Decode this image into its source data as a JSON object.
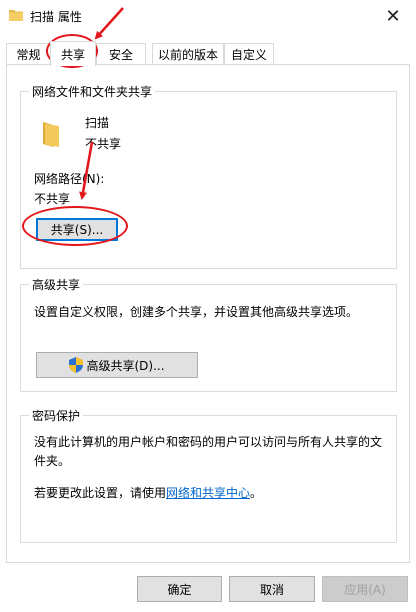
{
  "window": {
    "title": "扫描 属性",
    "close_glyph": "✕"
  },
  "tabs": [
    {
      "label": "常规",
      "active": false
    },
    {
      "label": "共享",
      "active": true
    },
    {
      "label": "安全",
      "active": false
    },
    {
      "label": "以前的版本",
      "active": false
    },
    {
      "label": "自定义",
      "active": false
    }
  ],
  "network_sharing": {
    "group_label": "网络文件和文件夹共享",
    "folder_name": "扫描",
    "folder_status": "不共享",
    "path_label": "网络路径(N):",
    "path_value": "不共享",
    "share_button": "共享(S)..."
  },
  "advanced_sharing": {
    "group_label": "高级共享",
    "description": "设置自定义权限，创建多个共享，并设置其他高级共享选项。",
    "button": "高级共享(D)..."
  },
  "password_protection": {
    "group_label": "密码保护",
    "description": "没有此计算机的用户帐户和密码的用户可以访问与所有人共享的文件夹。",
    "change_prefix": "若要更改此设置，请使用",
    "change_link": "网络和共享中心",
    "change_suffix": "。"
  },
  "footer": {
    "ok": "确定",
    "cancel": "取消",
    "apply": "应用(A)"
  },
  "colors": {
    "annotation_red": "#e3161b",
    "accent_blue": "#0078d7",
    "link_blue": "#0066cc",
    "folder_yellow": "#f0c24b"
  },
  "icons": {
    "title_icon": "folder-icon",
    "folder_icon": "folder-icon",
    "shield_icon": "uac-shield-icon"
  }
}
